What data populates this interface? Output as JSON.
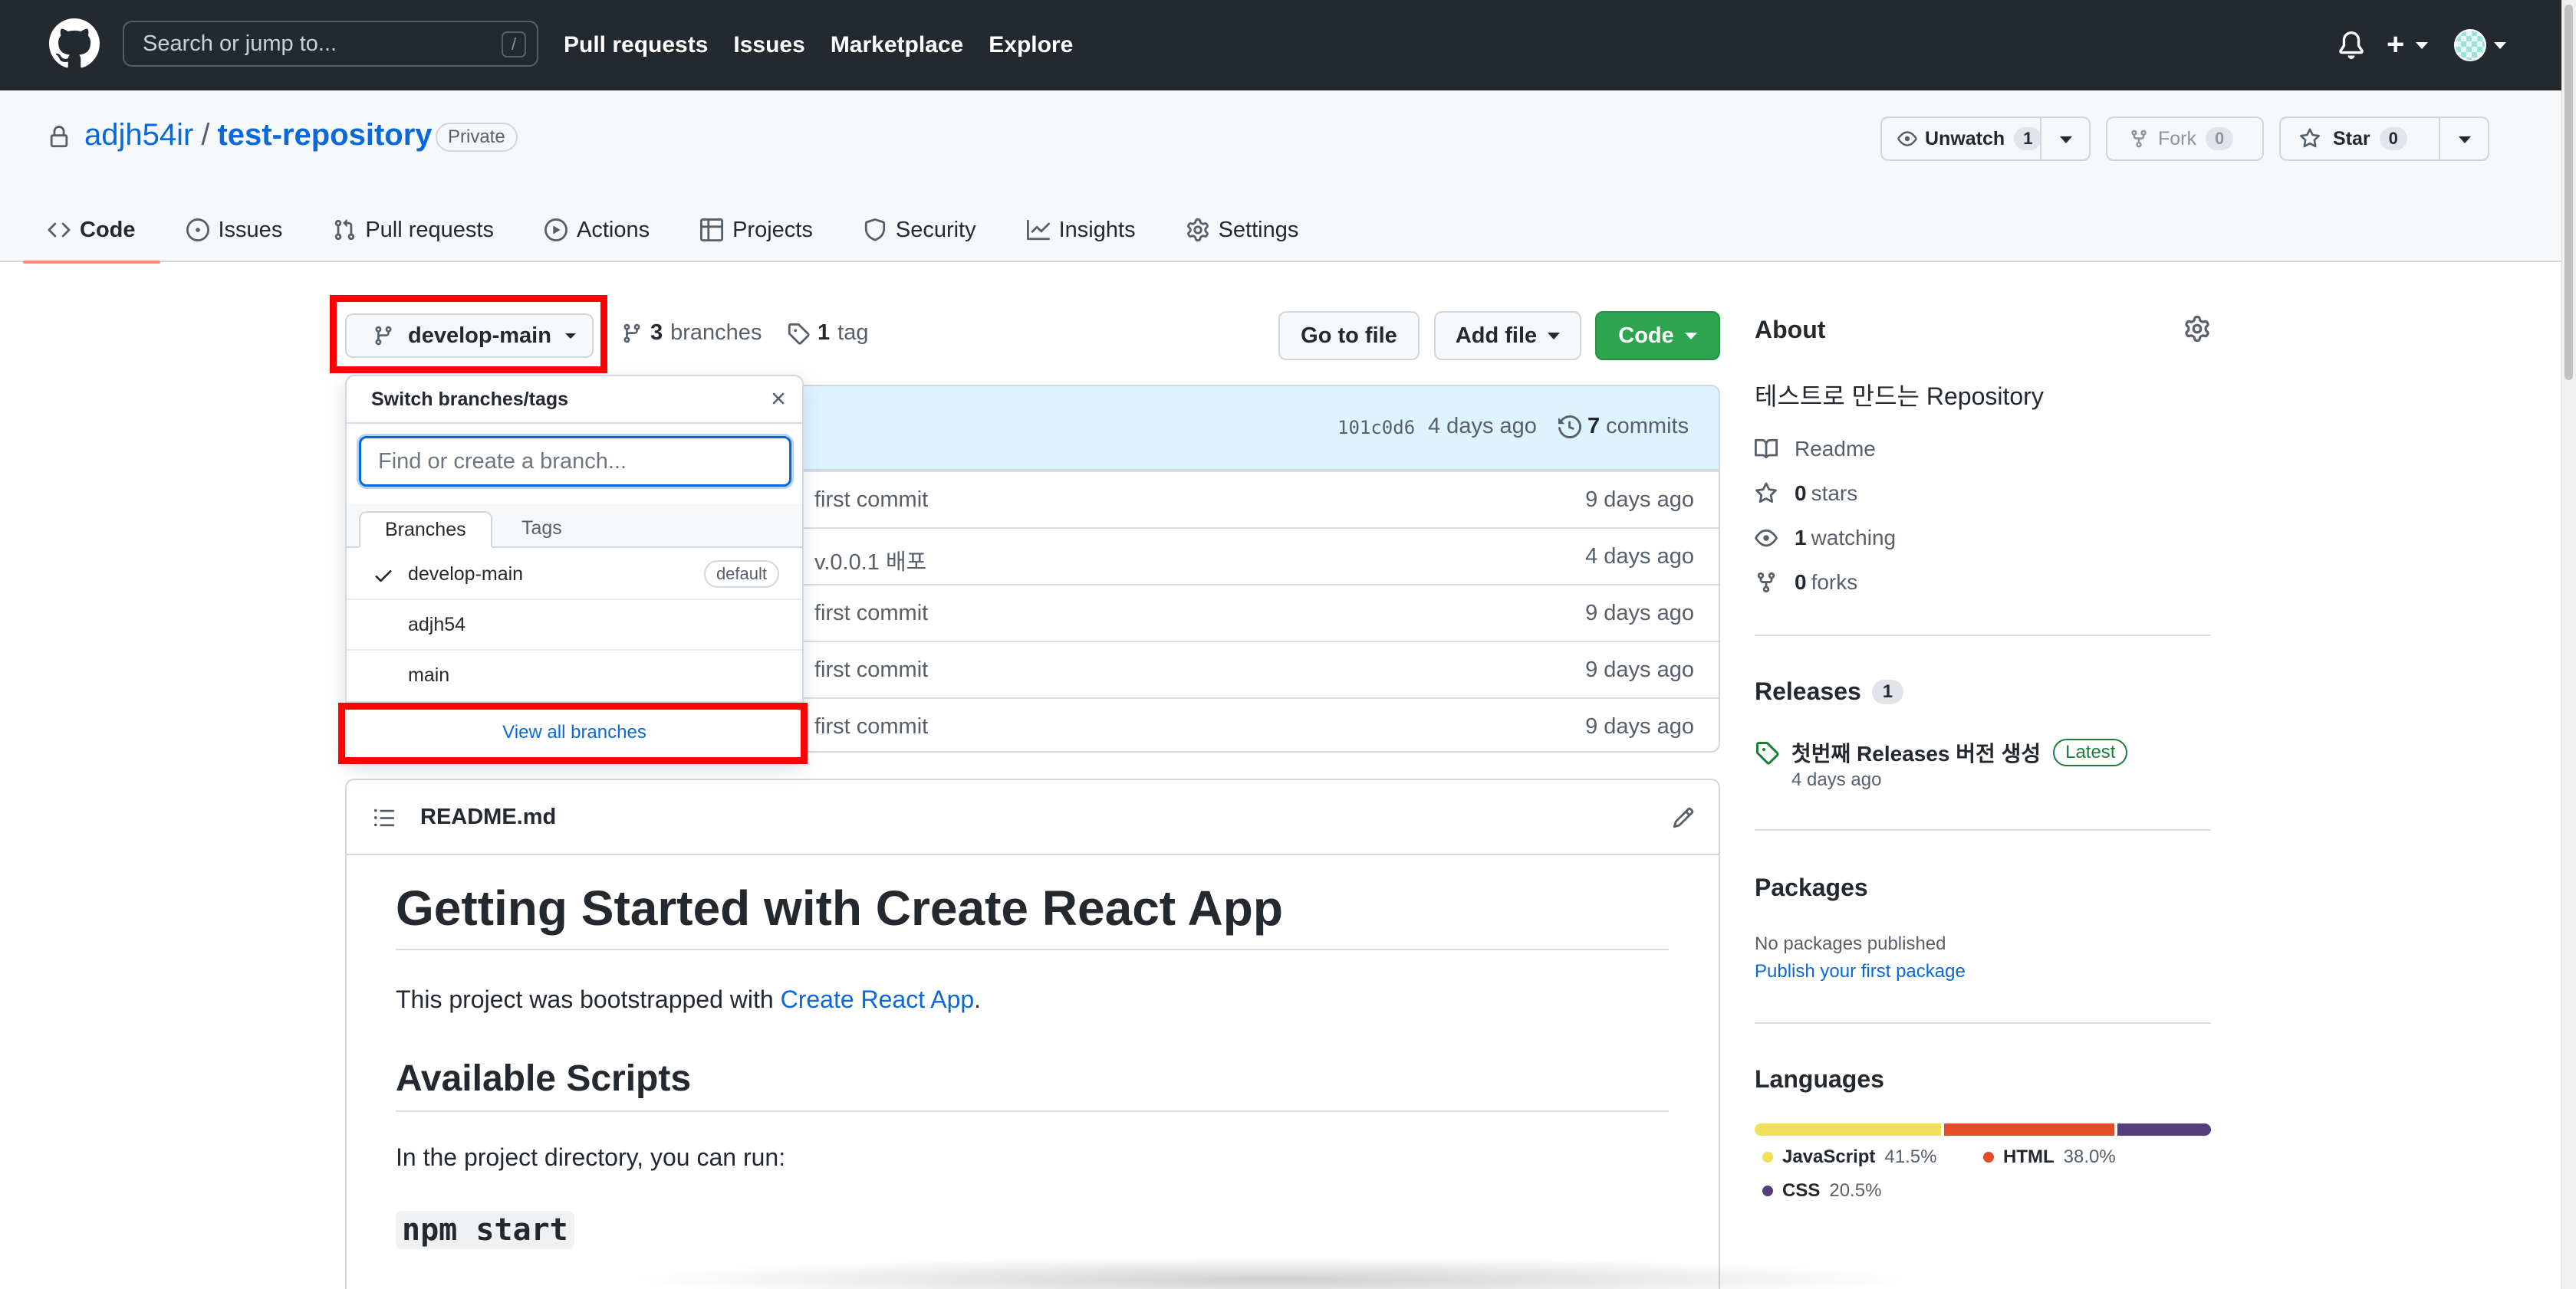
{
  "header": {
    "search_placeholder": "Search or jump to...",
    "search_shortcut": "/",
    "nav": [
      "Pull requests",
      "Issues",
      "Marketplace",
      "Explore"
    ]
  },
  "repo": {
    "owner": "adjh54ir",
    "separator": "/",
    "name": "test-repository",
    "visibility": "Private",
    "unwatch_label": "Unwatch",
    "watch_count": "1",
    "fork_label": "Fork",
    "fork_count": "0",
    "star_label": "Star",
    "star_count": "0"
  },
  "tabs": [
    {
      "label": "Code",
      "icon": "code-icon"
    },
    {
      "label": "Issues",
      "icon": "issue-icon"
    },
    {
      "label": "Pull requests",
      "icon": "pull-request-icon"
    },
    {
      "label": "Actions",
      "icon": "play-icon"
    },
    {
      "label": "Projects",
      "icon": "table-icon"
    },
    {
      "label": "Security",
      "icon": "shield-icon"
    },
    {
      "label": "Insights",
      "icon": "graph-icon"
    },
    {
      "label": "Settings",
      "icon": "gear-icon"
    }
  ],
  "toolbar": {
    "branch": "develop-main",
    "branches_count": "3",
    "branches_label": "branches",
    "tags_count": "1",
    "tags_label": "tag",
    "go_to_file": "Go to file",
    "add_file": "Add file",
    "code": "Code"
  },
  "commit": {
    "sha": "101c0d6",
    "ago": "4 days ago",
    "count": "7",
    "count_label": "commits"
  },
  "files": [
    {
      "message": "first commit",
      "age": "9 days ago"
    },
    {
      "message": "v.0.0.1 배포",
      "age": "4 days ago"
    },
    {
      "message": "first commit",
      "age": "9 days ago"
    },
    {
      "message": "first commit",
      "age": "9 days ago"
    },
    {
      "message": "first commit",
      "age": "9 days ago"
    }
  ],
  "dropdown": {
    "title": "Switch branches/tags",
    "input_placeholder": "Find or create a branch...",
    "tab_branches": "Branches",
    "tab_tags": "Tags",
    "branches": [
      {
        "name": "develop-main",
        "checked": true,
        "badge": "default"
      },
      {
        "name": "adjh54",
        "checked": false,
        "badge": ""
      },
      {
        "name": "main",
        "checked": false,
        "badge": ""
      }
    ],
    "view_all": "View all branches"
  },
  "readme": {
    "filename": "README.md",
    "h1": "Getting Started with Create React App",
    "p1_prefix": "This project was bootstrapped with ",
    "p1_link": "Create React App",
    "p1_suffix": ".",
    "h2": "Available Scripts",
    "p2": "In the project directory, you can run:",
    "h3": "npm start"
  },
  "sidebar": {
    "about_title": "About",
    "description": "테스트로 만드는 Repository",
    "readme": "Readme",
    "stars_count": "0",
    "stars_label": "stars",
    "watching_count": "1",
    "watching_label": "watching",
    "forks_count": "0",
    "forks_label": "forks",
    "releases_title": "Releases",
    "releases_count": "1",
    "release_name": "첫번째 Releases 버전 생성",
    "release_badge": "Latest",
    "release_date": "4 days ago",
    "packages_title": "Packages",
    "packages_none": "No packages published",
    "packages_link": "Publish your first package",
    "languages_title": "Languages",
    "languages": [
      {
        "name": "JavaScript",
        "percent": "41.5%",
        "value": 41.5,
        "color": "#f1e05a"
      },
      {
        "name": "HTML",
        "percent": "38.0%",
        "value": 38.0,
        "color": "#e34c26"
      },
      {
        "name": "CSS",
        "percent": "20.5%",
        "value": 20.5,
        "color": "#563d7c"
      }
    ]
  },
  "colors": {
    "header_bg": "#24292f",
    "link": "#0969da",
    "code_button": "#2da44e",
    "highlight": "#ff0000",
    "tab_underline": "#fd8c73"
  }
}
